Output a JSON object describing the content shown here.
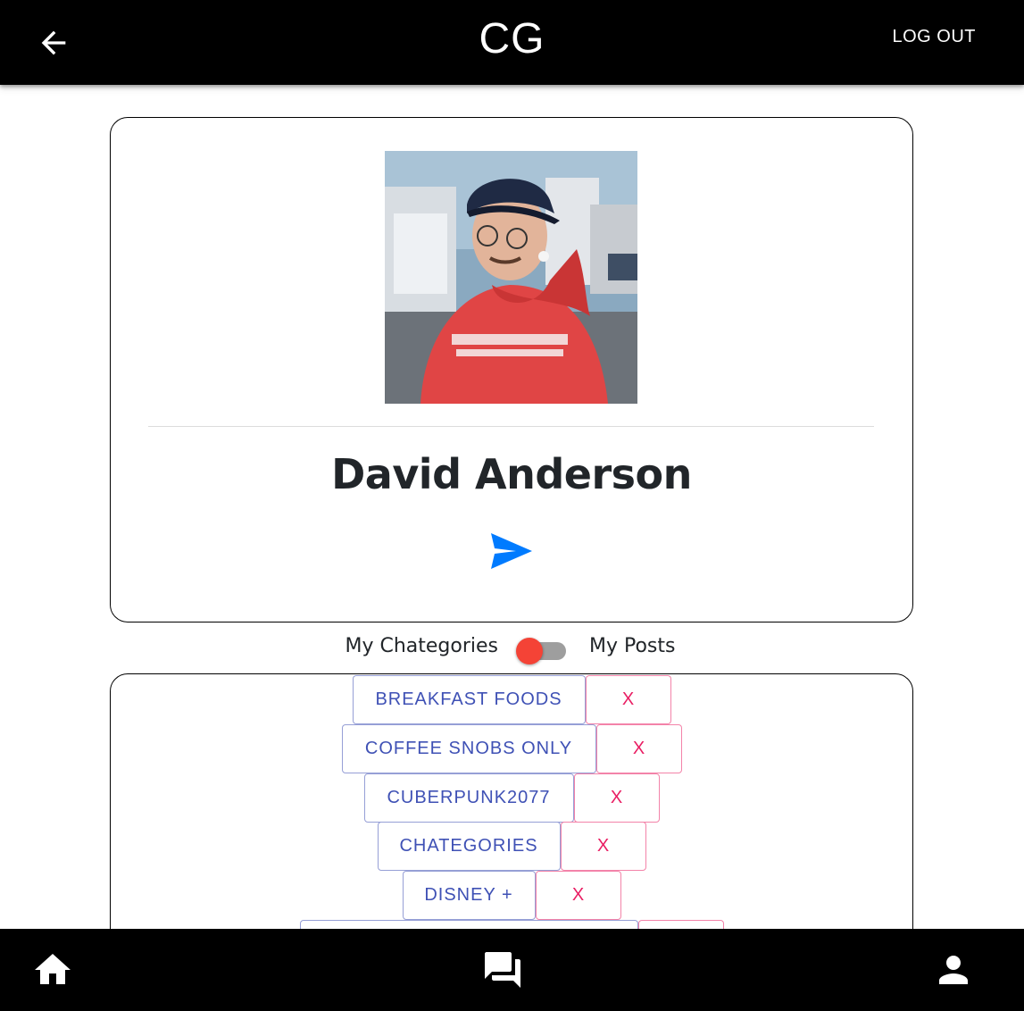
{
  "header": {
    "back_icon": "arrow-back-icon",
    "title": "CG",
    "logout_label": "LOG OUT"
  },
  "profile": {
    "name": "David Anderson",
    "avatar_description": "profile-photo",
    "send_icon": "send-icon",
    "send_icon_color": "#007bff"
  },
  "view_toggle": {
    "left_label": "My Chategories",
    "right_label": "My Posts",
    "thumb_color": "#f44336",
    "track_color": "#9e9e9e"
  },
  "categories": {
    "remove_label": "X",
    "items": [
      {
        "label": "BREAKFAST FOODS"
      },
      {
        "label": "COFFEE SNOBS ONLY"
      },
      {
        "label": "CUBERPUNK2077"
      },
      {
        "label": "CHATEGORIES"
      },
      {
        "label": "DISNEY +"
      },
      {
        "label": ""
      }
    ],
    "label_color": "#3f51b5",
    "remove_color": "#e91e63"
  },
  "bottom_nav": {
    "items": [
      {
        "icon": "home-icon"
      },
      {
        "icon": "forum-icon"
      },
      {
        "icon": "person-icon"
      }
    ]
  }
}
